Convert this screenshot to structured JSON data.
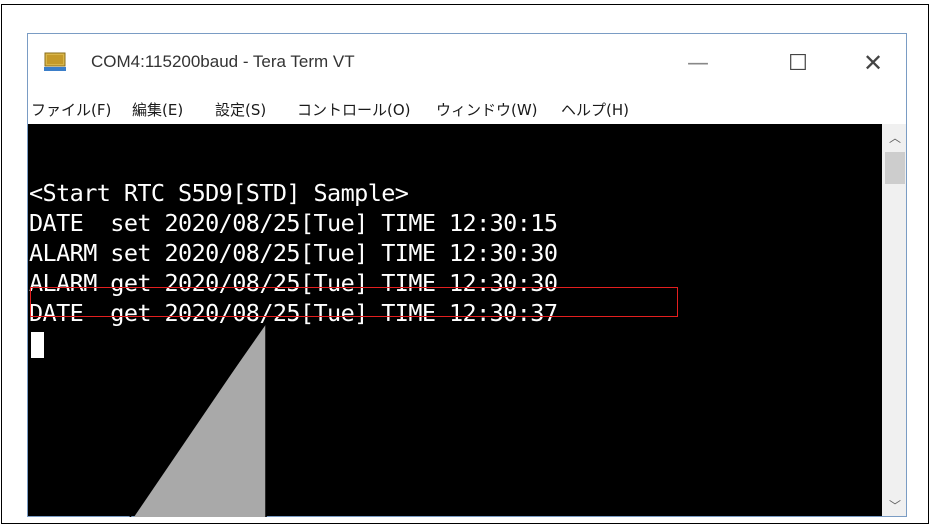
{
  "window": {
    "title": "COM4:115200baud - Tera Term VT",
    "minimize_glyph": "—",
    "maximize_glyph": "☐",
    "close_glyph": "✕"
  },
  "menu": {
    "items": [
      "ファイル(F)",
      "編集(E)",
      "設定(S)",
      "コントロール(O)",
      "ウィンドウ(W)",
      "ヘルプ(H)"
    ]
  },
  "terminal": {
    "lines": [
      "<Start RTC S5D9[STD] Sample>",
      "DATE  set 2020/08/25[Tue] TIME 12:30:15",
      "ALARM set 2020/08/25[Tue] TIME 12:30:30",
      "ALARM get 2020/08/25[Tue] TIME 12:30:30",
      "DATE  get 2020/08/25[Tue] TIME 12:30:37"
    ],
    "highlighted_line_index": 3
  },
  "scrollbar": {
    "up_icon": "chevron-up-icon",
    "down_icon": "chevron-down-icon",
    "up_glyph": "︿",
    "down_glyph": "﹀"
  },
  "colors": {
    "terminal_bg": "#000000",
    "terminal_fg": "#ffffff",
    "highlight_border": "#e41f1f",
    "callout_fill": "#a9a9a9"
  }
}
